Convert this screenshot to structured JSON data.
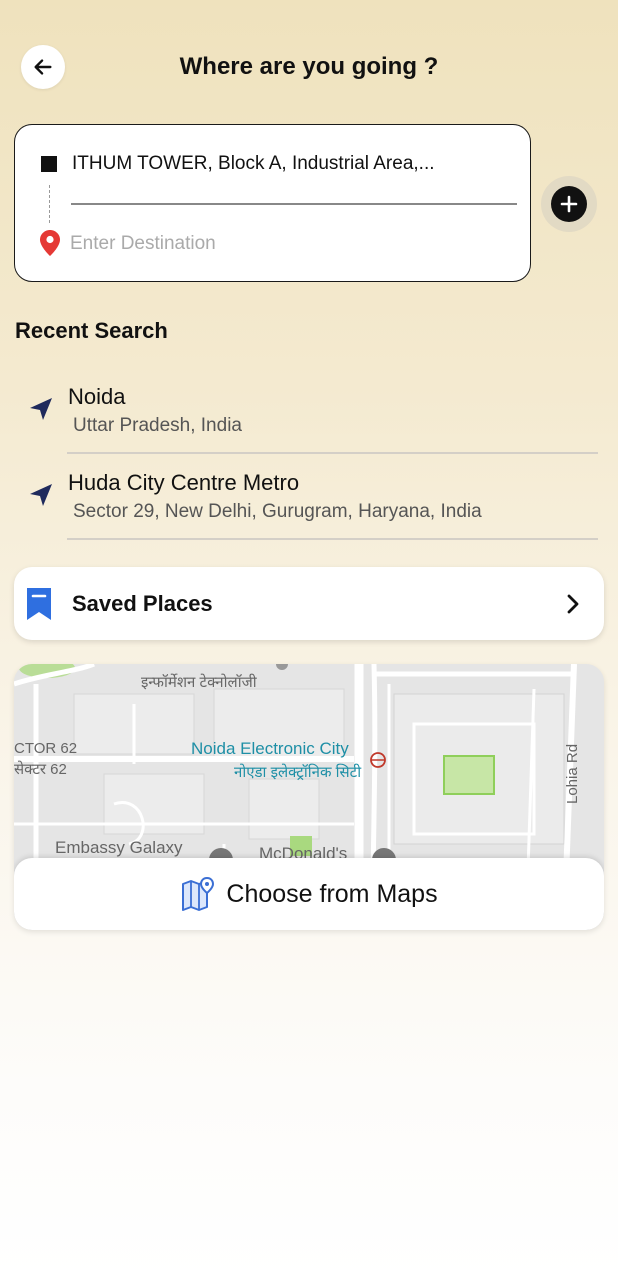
{
  "header": {
    "title": "Where are you going ?",
    "back_icon": "arrow-left-icon"
  },
  "location": {
    "pickup": "ITHUM TOWER, Block A, Industrial Area,...",
    "destination_value": "",
    "destination_placeholder": "Enter Destination",
    "pickup_icon": "square-icon",
    "destination_icon": "map-pin-icon",
    "pin_color": "#e53935"
  },
  "add_stop_icon": "plus-icon",
  "recent": {
    "title": "Recent Search",
    "items": [
      {
        "name": "Noida",
        "sub": "Uttar Pradesh, India",
        "icon": "navigation-arrow-icon"
      },
      {
        "name": "Huda City Centre Metro",
        "sub": "Sector 29, New Delhi, Gurugram, Haryana, India",
        "icon": "navigation-arrow-icon"
      }
    ],
    "icon_color": "#1f2a5c"
  },
  "saved_places": {
    "label": "Saved Places",
    "icon": "bookmark-icon",
    "icon_color": "#2f6fe0"
  },
  "map": {
    "labels": {
      "info_tech": "इन्फॉर्मेशन टेक्नोलॉजी",
      "sector_en": "CTOR 62",
      "sector_hi": "सेक्टर 62",
      "noida_ec_en": "Noida Electronic City",
      "noida_ec_hi": "नोएडा इलेक्ट्रॉनिक सिटी",
      "embassy": "Embassy Galaxy",
      "mcdonalds": "McDonald's",
      "lohia": "Lohia Rd"
    },
    "choose_label": "Choose from Maps",
    "choose_icon": "map-pin-icon"
  }
}
